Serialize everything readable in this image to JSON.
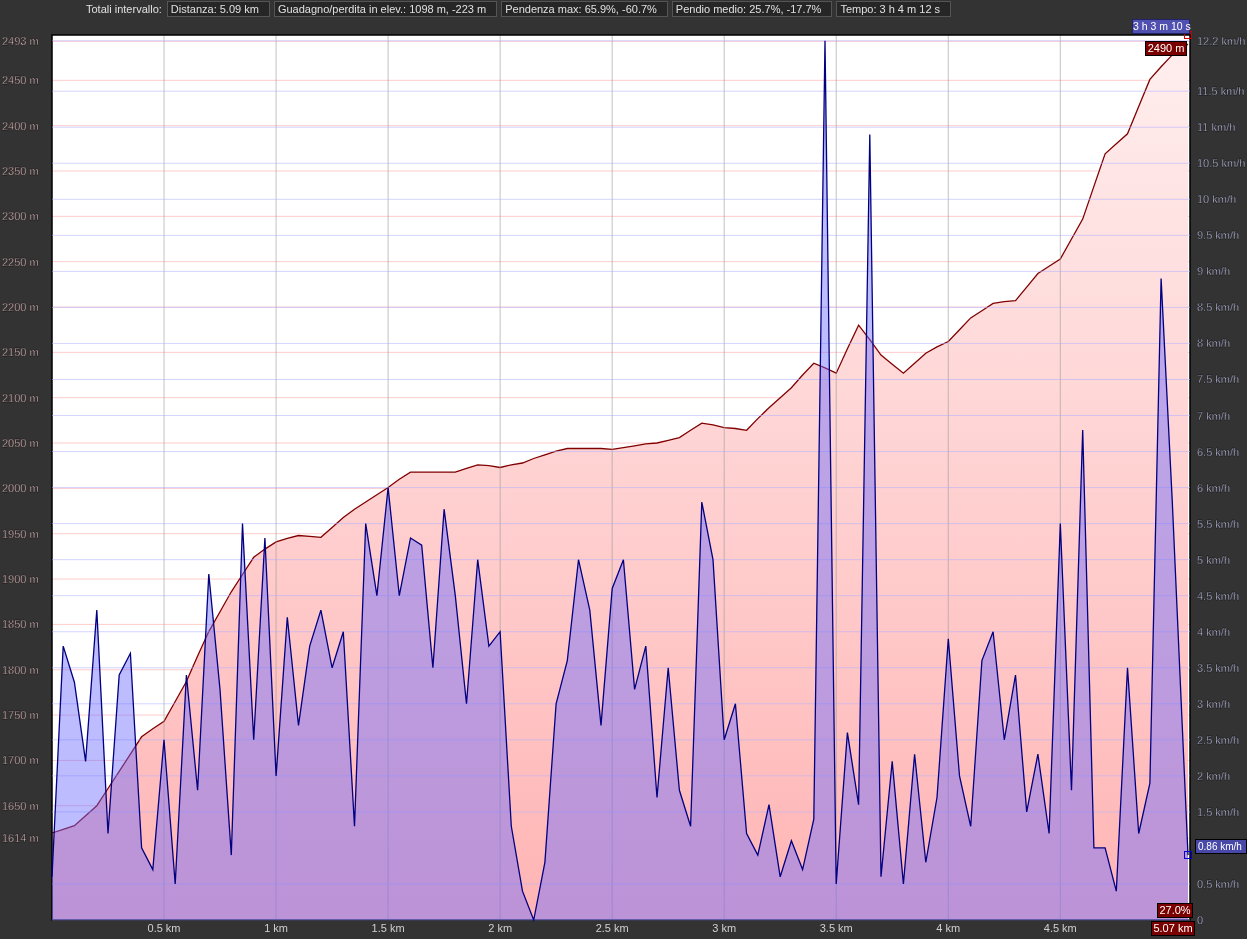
{
  "summary": {
    "label": "Totali intervallo:",
    "items": [
      "Distanza: 5.09 km",
      "Guadagno/perdita in elev.: 1098 m, -223 m",
      "Pendenza max: 65.9%, -60.7%",
      "Pendio medio: 25.7%, -17.7%",
      "Tempo: 3 h 4 m 12 s"
    ]
  },
  "cursor": {
    "time": "3 h 3 m 10 s",
    "elevation": "2490 m",
    "grade": "27.0%",
    "distance": "5.07 km",
    "speed": "0.86 km/h"
  },
  "elevation_chart": {
    "chart_data": {
      "type": "area",
      "grid": true,
      "xlim": [
        0,
        5.07
      ],
      "ylim": [
        1524,
        2500
      ],
      "xticks": [
        {
          "value": 0.5,
          "label": "0.5 km"
        },
        {
          "value": 1,
          "label": "1 km"
        },
        {
          "value": 1.5,
          "label": "1.5 km"
        },
        {
          "value": 2,
          "label": "2 km"
        },
        {
          "value": 2.5,
          "label": "2.5 km"
        },
        {
          "value": 3,
          "label": "3 km"
        },
        {
          "value": 3.5,
          "label": "3.5 km"
        },
        {
          "value": 4,
          "label": "4 km"
        },
        {
          "value": 4.5,
          "label": "4.5 km"
        }
      ],
      "yticks": [
        {
          "value": 2493,
          "label": "2493 m"
        },
        {
          "value": 2450,
          "label": "2450 m"
        },
        {
          "value": 2400,
          "label": "2400 m"
        },
        {
          "value": 2350,
          "label": "2350 m"
        },
        {
          "value": 2300,
          "label": "2300 m"
        },
        {
          "value": 2250,
          "label": "2250 m"
        },
        {
          "value": 2200,
          "label": "2200 m"
        },
        {
          "value": 2150,
          "label": "2150 m"
        },
        {
          "value": 2100,
          "label": "2100 m"
        },
        {
          "value": 2050,
          "label": "2050 m"
        },
        {
          "value": 2000,
          "label": "2000 m"
        },
        {
          "value": 1950,
          "label": "1950 m"
        },
        {
          "value": 1900,
          "label": "1900 m"
        },
        {
          "value": 1850,
          "label": "1850 m"
        },
        {
          "value": 1800,
          "label": "1800 m"
        },
        {
          "value": 1750,
          "label": "1750 m"
        },
        {
          "value": 1700,
          "label": "1700 m"
        },
        {
          "value": 1650,
          "label": "1650 m"
        },
        {
          "value": 1614,
          "label": "1614 m"
        }
      ],
      "x": [
        0,
        0.05,
        0.1,
        0.15,
        0.2,
        0.25,
        0.3,
        0.35,
        0.4,
        0.45,
        0.5,
        0.55,
        0.6,
        0.65,
        0.7,
        0.75,
        0.8,
        0.85,
        0.9,
        0.95,
        1,
        1.05,
        1.1,
        1.15,
        1.2,
        1.25,
        1.3,
        1.35,
        1.4,
        1.45,
        1.5,
        1.55,
        1.6,
        1.65,
        1.7,
        1.75,
        1.8,
        1.85,
        1.9,
        1.95,
        2,
        2.05,
        2.1,
        2.15,
        2.2,
        2.25,
        2.3,
        2.35,
        2.4,
        2.45,
        2.5,
        2.55,
        2.6,
        2.65,
        2.7,
        2.75,
        2.8,
        2.85,
        2.9,
        2.95,
        3,
        3.05,
        3.1,
        3.15,
        3.2,
        3.25,
        3.3,
        3.35,
        3.4,
        3.45,
        3.5,
        3.55,
        3.6,
        3.65,
        3.7,
        3.75,
        3.8,
        3.85,
        3.9,
        3.95,
        4,
        4.05,
        4.1,
        4.15,
        4.2,
        4.25,
        4.3,
        4.35,
        4.4,
        4.45,
        4.5,
        4.55,
        4.6,
        4.65,
        4.7,
        4.75,
        4.8,
        4.85,
        4.9,
        4.95,
        5,
        5.07
      ],
      "series": [
        {
          "color": "#800000",
          "values": [
            1620,
            1624,
            1628,
            1639,
            1650,
            1669,
            1688,
            1707,
            1726,
            1735,
            1743,
            1765,
            1787,
            1815,
            1842,
            1864,
            1886,
            1905,
            1924,
            1933,
            1941,
            1945,
            1948,
            1947,
            1946,
            1957,
            1968,
            1977,
            1985,
            1993,
            2001,
            2010,
            2018,
            2018,
            2018,
            2018,
            2018,
            2022,
            2026,
            2025,
            2023,
            2026,
            2028,
            2033,
            2037,
            2041,
            2044,
            2044,
            2044,
            2044,
            2043,
            2045,
            2047,
            2049,
            2050,
            2053,
            2056,
            2064,
            2072,
            2070,
            2067,
            2066,
            2064,
            2077,
            2089,
            2100,
            2111,
            2125,
            2138,
            2133,
            2127,
            2154,
            2180,
            2164,
            2147,
            2137,
            2127,
            2138,
            2149,
            2156,
            2162,
            2175,
            2188,
            2196,
            2204,
            2206,
            2207,
            2222,
            2237,
            2245,
            2253,
            2275,
            2297,
            2333,
            2369,
            2380,
            2391,
            2421,
            2451,
            2465,
            2478,
            2490
          ]
        }
      ]
    }
  },
  "speed_chart": {
    "chart_data": {
      "type": "area",
      "grid": true,
      "xlim": [
        0,
        5.07
      ],
      "ylim": [
        0,
        12.28
      ],
      "yticks": [
        {
          "value": 12.2,
          "label": "12.2 km/h"
        },
        {
          "value": 11.5,
          "label": "11.5 km/h"
        },
        {
          "value": 11,
          "label": "11 km/h"
        },
        {
          "value": 10.5,
          "label": "10.5 km/h"
        },
        {
          "value": 10,
          "label": "10 km/h"
        },
        {
          "value": 9.5,
          "label": "9.5 km/h"
        },
        {
          "value": 9,
          "label": "9 km/h"
        },
        {
          "value": 8.5,
          "label": "8.5 km/h"
        },
        {
          "value": 8,
          "label": "8 km/h"
        },
        {
          "value": 7.5,
          "label": "7.5 km/h"
        },
        {
          "value": 7,
          "label": "7 km/h"
        },
        {
          "value": 6.5,
          "label": "6.5 km/h"
        },
        {
          "value": 6,
          "label": "6 km/h"
        },
        {
          "value": 5.5,
          "label": "5.5 km/h"
        },
        {
          "value": 5,
          "label": "5 km/h"
        },
        {
          "value": 4.5,
          "label": "4.5 km/h"
        },
        {
          "value": 4,
          "label": "4 km/h"
        },
        {
          "value": 3.5,
          "label": "3.5 km/h"
        },
        {
          "value": 3,
          "label": "3 km/h"
        },
        {
          "value": 2.5,
          "label": "2.5 km/h"
        },
        {
          "value": 2,
          "label": "2 km/h"
        },
        {
          "value": 1.5,
          "label": "1.5 km/h"
        },
        {
          "value": 0.5,
          "label": "0.5 km/h"
        },
        {
          "value": 0,
          "label": "0"
        }
      ],
      "x": [
        0,
        0.05,
        0.1,
        0.15,
        0.2,
        0.25,
        0.3,
        0.35,
        0.4,
        0.45,
        0.5,
        0.55,
        0.6,
        0.65,
        0.7,
        0.75,
        0.8,
        0.85,
        0.9,
        0.95,
        1,
        1.05,
        1.1,
        1.15,
        1.2,
        1.25,
        1.3,
        1.35,
        1.4,
        1.45,
        1.5,
        1.55,
        1.6,
        1.65,
        1.7,
        1.75,
        1.8,
        1.85,
        1.9,
        1.95,
        2,
        2.05,
        2.1,
        2.15,
        2.2,
        2.25,
        2.3,
        2.35,
        2.4,
        2.45,
        2.5,
        2.55,
        2.6,
        2.65,
        2.7,
        2.75,
        2.8,
        2.85,
        2.9,
        2.95,
        3,
        3.05,
        3.1,
        3.15,
        3.2,
        3.25,
        3.3,
        3.35,
        3.4,
        3.45,
        3.5,
        3.55,
        3.6,
        3.65,
        3.7,
        3.75,
        3.8,
        3.85,
        3.9,
        3.95,
        4,
        4.05,
        4.1,
        4.15,
        4.2,
        4.25,
        4.3,
        4.35,
        4.4,
        4.45,
        4.5,
        4.55,
        4.6,
        4.65,
        4.7,
        4.75,
        4.8,
        4.85,
        4.9,
        4.95,
        5,
        5.07
      ],
      "series": [
        {
          "color": "#000080",
          "values": [
            0.6,
            3.8,
            3.3,
            2.2,
            4.3,
            1.2,
            3.4,
            3.7,
            1,
            0.7,
            2.5,
            0.5,
            3.4,
            1.8,
            4.8,
            3.2,
            0.9,
            5.5,
            2.5,
            5.3,
            2,
            4.2,
            2.7,
            3.8,
            4.3,
            3.5,
            4,
            1.3,
            5.5,
            4.5,
            6,
            4.5,
            5.3,
            5.2,
            3.5,
            5.7,
            4.5,
            3,
            5,
            3.8,
            4,
            1.3,
            0.4,
            0,
            0.8,
            3,
            3.6,
            5,
            4.3,
            2.7,
            4.6,
            5,
            3.2,
            3.8,
            1.7,
            3.5,
            1.8,
            1.3,
            5.8,
            5,
            2.5,
            3,
            1.2,
            0.9,
            1.6,
            0.6,
            1.1,
            0.7,
            1.4,
            12.2,
            0.5,
            2.6,
            1.6,
            10.9,
            0.6,
            2.2,
            0.5,
            2.3,
            0.8,
            1.7,
            3.9,
            2,
            1.3,
            3.6,
            4,
            2.5,
            3.4,
            1.5,
            2.3,
            1.2,
            5.5,
            1.8,
            6.8,
            1,
            1,
            0.4,
            3.5,
            1.2,
            1.9,
            8.9,
            5.8,
            0.9
          ]
        }
      ]
    }
  }
}
